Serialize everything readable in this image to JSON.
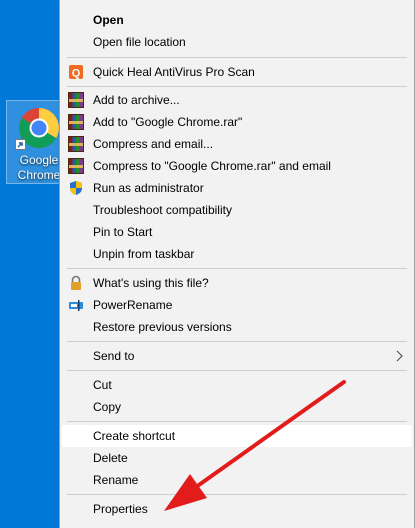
{
  "desktop": {
    "shortcut_label": "Google\nChrome"
  },
  "menu": {
    "open": "Open",
    "open_file_location": "Open file location",
    "quick_heal": "Quick Heal AntiVirus Pro Scan",
    "add_to_archive": "Add to archive...",
    "add_to_rar": "Add to \"Google Chrome.rar\"",
    "compress_email": "Compress and email...",
    "compress_rar_email": "Compress to \"Google Chrome.rar\" and email",
    "run_as_admin": "Run as administrator",
    "troubleshoot": "Troubleshoot compatibility",
    "pin_to_start": "Pin to Start",
    "unpin_taskbar": "Unpin from taskbar",
    "whats_using": "What's using this file?",
    "powerrename": "PowerRename",
    "restore_previous": "Restore previous versions",
    "send_to": "Send to",
    "cut": "Cut",
    "copy": "Copy",
    "create_shortcut": "Create shortcut",
    "delete": "Delete",
    "rename": "Rename",
    "properties": "Properties"
  },
  "colors": {
    "desktop_bg": "#0078d7",
    "menu_bg": "#f2f2f2",
    "annotation_arrow": "#e21b1b"
  },
  "icons": {
    "quick_heal": "quick-heal-icon",
    "winrar": "winrar-icon",
    "uac_shield": "uac-shield-icon",
    "lock": "lock-icon",
    "powerrename": "powerrename-icon",
    "submenu": "chevron-right-icon"
  }
}
